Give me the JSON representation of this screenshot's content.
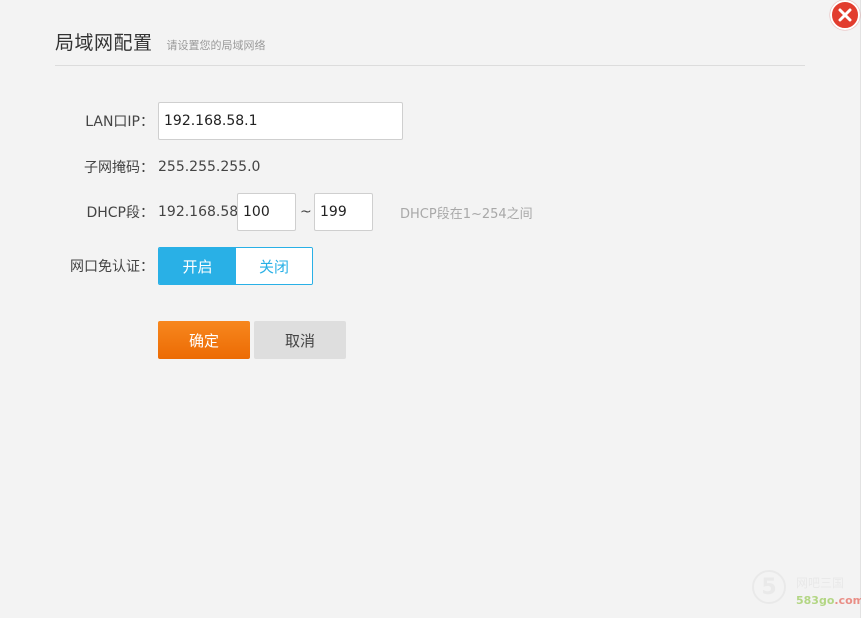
{
  "dialog": {
    "title": "局域网配置",
    "subtitle": "请设置您的局域网络"
  },
  "close": {
    "icon": "close-icon",
    "color": "#e23c2e"
  },
  "lan_ip": {
    "label": "LAN口IP：",
    "value": "192.168.58.1"
  },
  "subnet": {
    "label": "子网掩码：",
    "value": "255.255.255.0"
  },
  "dhcp": {
    "label": "DHCP段：",
    "prefix": "192.168.58.",
    "start": "100",
    "separator": "~",
    "end": "199",
    "hint": "DHCP段在1~254之间"
  },
  "auth_free": {
    "label": "网口免认证：",
    "on_label": "开启",
    "off_label": "关闭",
    "selected": "开启",
    "accent": "#29b0e6"
  },
  "actions": {
    "confirm_label": "确定",
    "cancel_label": "取消",
    "confirm_color": "#ec6b04"
  },
  "watermark": {
    "number": "5",
    "text": "网吧三国",
    "site_prefix": "583go",
    "site_suffix": ".com"
  }
}
